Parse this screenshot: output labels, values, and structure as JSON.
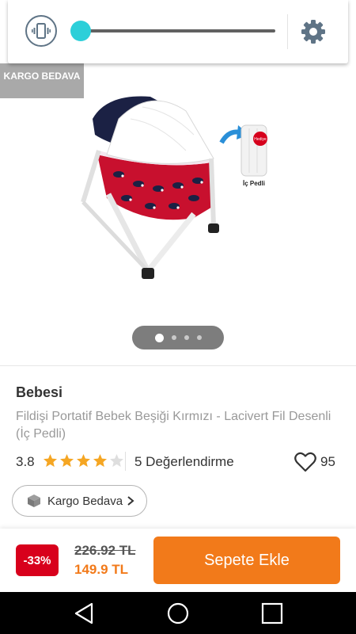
{
  "volume_panel": {
    "vibrate_icon": "vibrate-icon",
    "settings_icon": "gear-icon",
    "level": 0.0,
    "accent_color": "#2ccfd9"
  },
  "product": {
    "badge": "KARGO BEDAVA",
    "image_caption": "İç Pedli",
    "image_tag": "Hediye",
    "gallery": {
      "count": 4,
      "active": 0
    },
    "brand": "Bebesi",
    "name": "Fildişi Portatif Bebek Beşiği Kırmızı - Lacivert Fil Desenli (İç Pedli)",
    "rating": "3.8",
    "rating_value": 3.8,
    "rating_max": 5,
    "reviews": "5 Değerlendirme",
    "favorites": "95",
    "cargo_label": "Kargo Bedava"
  },
  "price_bar": {
    "discount": "-33%",
    "old_price": "226.92 TL",
    "new_price": "149.9 TL",
    "cart_label": "Sepete Ekle",
    "accent_color": "#f27a1a"
  },
  "nav": {
    "back_icon": "back-triangle-icon",
    "home_icon": "home-circle-icon",
    "recents_icon": "recents-square-icon"
  }
}
